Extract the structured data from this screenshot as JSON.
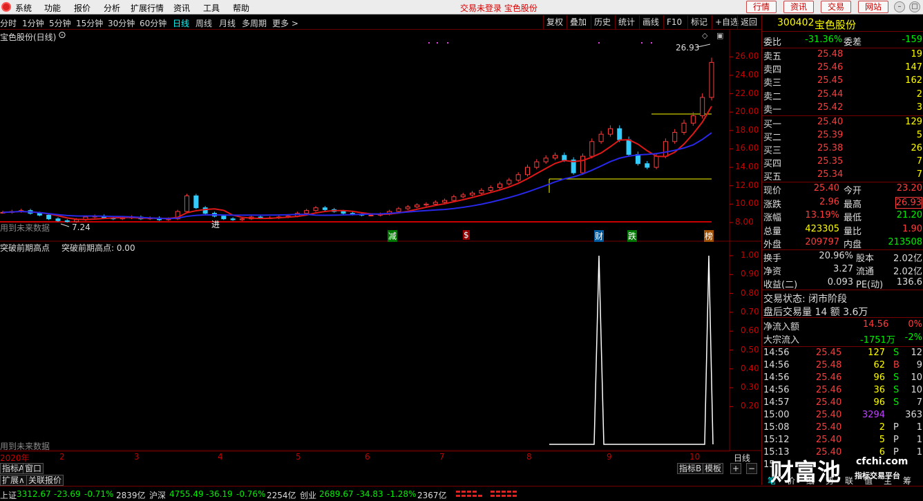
{
  "menu": {
    "items": [
      "系统",
      "功能",
      "报价",
      "分析",
      "扩展行情",
      "资讯",
      "工具",
      "帮助"
    ],
    "status": "交易未登录 宝色股份",
    "top_buttons": [
      "行情",
      "资讯",
      "交易",
      "网站"
    ]
  },
  "toolbar": {
    "periods": [
      "分时",
      "1分钟",
      "5分钟",
      "15分钟",
      "30分钟",
      "60分钟",
      "日线",
      "周线",
      "月线",
      "多周期",
      "更多 >"
    ],
    "active_period": "日线",
    "right_buttons": [
      "复权",
      "叠加",
      "历史",
      "统计",
      "画线",
      "F10",
      "标记",
      "+自选",
      "返回"
    ]
  },
  "main_chart": {
    "title": "宝色股份(日线)",
    "high_label": "26.93",
    "low_label": "7.24",
    "future_label": "用到未来数据",
    "entry_label": "进",
    "event_labels": [
      "减",
      "$",
      "财",
      "跌",
      "榜"
    ],
    "y_ticks": [
      "26.00",
      "24.00",
      "22.00",
      "20.00",
      "18.00",
      "16.00",
      "14.00",
      "12.00",
      "10.00",
      "8.00"
    ]
  },
  "sub_chart": {
    "title": "突破前期高点",
    "value_text": "突破前期高点: 0.00",
    "future_label": "用到未来数据",
    "y_ticks": [
      "1.00",
      "0.90",
      "0.80",
      "0.70",
      "0.60",
      "0.50",
      "0.40",
      "0.30",
      "0.20"
    ]
  },
  "x_axis": {
    "labels": [
      "2020年",
      "2",
      "3",
      "4",
      "5",
      "6",
      "7",
      "8",
      "9",
      "10"
    ],
    "period_label": "日线"
  },
  "bottom_left": {
    "tabs": [
      "指标A",
      "窗口",
      "扩展∧",
      "关联报价"
    ],
    "right_tabs": [
      "指标B",
      "模板",
      "+",
      "−"
    ]
  },
  "chart_data": {
    "type": "line",
    "series": [
      {
        "name": "close",
        "values": [
          9.1,
          9.2,
          9.3,
          9.0,
          8.8,
          8.4,
          8.2,
          8.1,
          8.3,
          8.6,
          8.7,
          8.5,
          8.4,
          8.5,
          8.6,
          8.4,
          8.5,
          8.3,
          8.4,
          9.2,
          10.9,
          9.6,
          9.0,
          8.7,
          8.4,
          8.3,
          8.4,
          8.6,
          8.5,
          8.5,
          8.6,
          8.7,
          9.0,
          9.3,
          9.6,
          9.4,
          9.2,
          9.0,
          8.9,
          8.8,
          8.8,
          8.9,
          9.2,
          9.5,
          9.7,
          9.9,
          10.0,
          10.2,
          10.4,
          10.8,
          11.0,
          11.2,
          11.5,
          11.8,
          12.2,
          12.6,
          13.2,
          14.0,
          14.6,
          15.0,
          15.3,
          14.8,
          13.4,
          15.2,
          16.8,
          17.6,
          18.2,
          17.0,
          15.4,
          14.4,
          14.0,
          15.2,
          16.8,
          17.8,
          18.8,
          19.6,
          21.6,
          25.4
        ]
      }
    ],
    "ma_short": "red",
    "ma_long": "blue",
    "indicator": {
      "name": "突破前期高点",
      "spikes": [
        0.0,
        1.0,
        0.0,
        1.0
      ],
      "ylim": [
        0,
        1
      ]
    }
  },
  "quote": {
    "code": "300402",
    "name": "宝色股份",
    "weibi_label": "委比",
    "weibi": "-31.36%",
    "weicha_label": "委差",
    "weicha": "-159",
    "sell": [
      {
        "label": "卖五",
        "price": "25.48",
        "vol": "19"
      },
      {
        "label": "卖四",
        "price": "25.46",
        "vol": "147"
      },
      {
        "label": "卖三",
        "price": "25.45",
        "vol": "162"
      },
      {
        "label": "卖二",
        "price": "25.44",
        "vol": "2"
      },
      {
        "label": "卖一",
        "price": "25.42",
        "vol": "3"
      }
    ],
    "buy": [
      {
        "label": "买一",
        "price": "25.40",
        "vol": "129"
      },
      {
        "label": "买二",
        "price": "25.39",
        "vol": "5"
      },
      {
        "label": "买三",
        "price": "25.38",
        "vol": "26"
      },
      {
        "label": "买四",
        "price": "25.35",
        "vol": "7"
      },
      {
        "label": "买五",
        "price": "25.34",
        "vol": "7"
      }
    ],
    "stats": [
      {
        "l1": "现价",
        "v1": "25.40",
        "l2": "今开",
        "v2": "23.20"
      },
      {
        "l1": "涨跌",
        "v1": "2.96",
        "l2": "最高",
        "v2": "26.93"
      },
      {
        "l1": "涨幅",
        "v1": "13.19%",
        "l2": "最低",
        "v2": "21.20"
      },
      {
        "l1": "总量",
        "v1": "423305",
        "l2": "量比",
        "v2": "1.90"
      },
      {
        "l1": "外盘",
        "v1": "209797",
        "l2": "内盘",
        "v2": "213508"
      }
    ],
    "stats2": [
      {
        "l1": "换手",
        "v1": "20.96%",
        "l2": "股本",
        "v2": "2.02亿"
      },
      {
        "l1": "净资",
        "v1": "3.27",
        "l2": "流通",
        "v2": "2.02亿"
      },
      {
        "l1": "收益(二)",
        "v1": "0.093",
        "l2": "PE(动)",
        "v2": "136.6"
      }
    ],
    "trade_status": "交易状态: 闭市阶段",
    "after_hours": "盘后交易量 14 额 3.6万",
    "net_inflow_label": "净流入额",
    "net_inflow": "14.56",
    "net_inflow_pct": "0%",
    "block_label": "大宗流入",
    "block": "-1751万",
    "block_pct": "-2%",
    "ticks": [
      {
        "time": "14:56",
        "price": "25.45",
        "vol": "127",
        "bs": "S",
        "n": "12"
      },
      {
        "time": "14:56",
        "price": "25.48",
        "vol": "62",
        "bs": "B",
        "n": "9"
      },
      {
        "time": "14:56",
        "price": "25.46",
        "vol": "96",
        "bs": "S",
        "n": "10"
      },
      {
        "time": "14:56",
        "price": "25.46",
        "vol": "36",
        "bs": "S",
        "n": "10"
      },
      {
        "time": "14:57",
        "price": "25.40",
        "vol": "96",
        "bs": "S",
        "n": "7"
      },
      {
        "time": "15:00",
        "price": "25.40",
        "vol": "3294",
        "bs": "",
        "n": "363"
      },
      {
        "time": "15:08",
        "price": "25.40",
        "vol": "2",
        "bs": "P",
        "n": "1"
      },
      {
        "time": "15:12",
        "price": "25.40",
        "vol": "5",
        "bs": "P",
        "n": "1"
      },
      {
        "time": "15:13",
        "price": "25.40",
        "vol": "6",
        "bs": "P",
        "n": "1"
      },
      {
        "time": "15",
        "price": "",
        "vol": "",
        "bs": "",
        "n": ""
      }
    ],
    "bottom_tabs": [
      "笔",
      "价",
      "细",
      "势",
      "联",
      "值",
      "主",
      "筹"
    ]
  },
  "indices": [
    {
      "name": "上证",
      "value": "3312.67",
      "chg": "-23.69",
      "pct": "-0.71%",
      "amt": "2839亿"
    },
    {
      "name": "沪深",
      "value": "4755.49",
      "chg": "-36.19",
      "pct": "-0.76%",
      "amt": "2254亿"
    },
    {
      "name": "创业",
      "value": "2689.67",
      "chg": "-34.83",
      "pct": "-1.28%",
      "amt": "2367亿"
    }
  ],
  "watermark": {
    "brand": "财富池",
    "site": "cfchi.com",
    "slogan": "指标交易平台"
  },
  "colors": {
    "up": "#ff3c3c",
    "down": "#00e600",
    "price": "#e8e8e8",
    "label": "#c8c8c8",
    "grid": "#700000",
    "accent": "#00ffff",
    "yellow": "#ffff50"
  }
}
